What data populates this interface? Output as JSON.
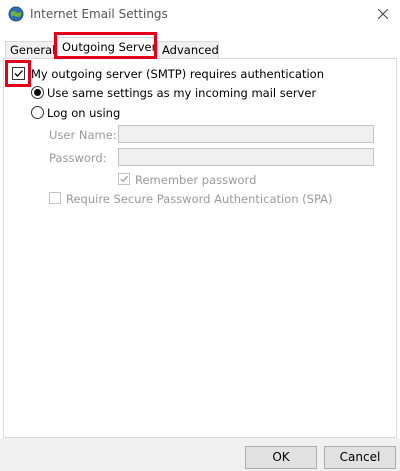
{
  "window": {
    "title": "Internet Email Settings"
  },
  "tabs": [
    {
      "label": "General"
    },
    {
      "label": "Outgoing Server"
    },
    {
      "label": "Advanced"
    }
  ],
  "outgoing": {
    "smtp_auth_label": "My outgoing server (SMTP) requires authentication",
    "smtp_auth_checked": true,
    "use_same_label": "Use same settings as my incoming mail server",
    "use_same_selected": true,
    "log_on_label": "Log on using",
    "log_on_selected": false,
    "user_name_label": "User Name:",
    "user_name_value": "",
    "password_label": "Password:",
    "password_value": "",
    "remember_label": "Remember password",
    "remember_checked": true,
    "spa_label": "Require Secure Password Authentication (SPA)",
    "spa_checked": false
  },
  "buttons": {
    "ok": "OK",
    "cancel": "Cancel"
  },
  "colors": {
    "highlight": "#e3001b",
    "disabled": "#9a9a9a"
  }
}
